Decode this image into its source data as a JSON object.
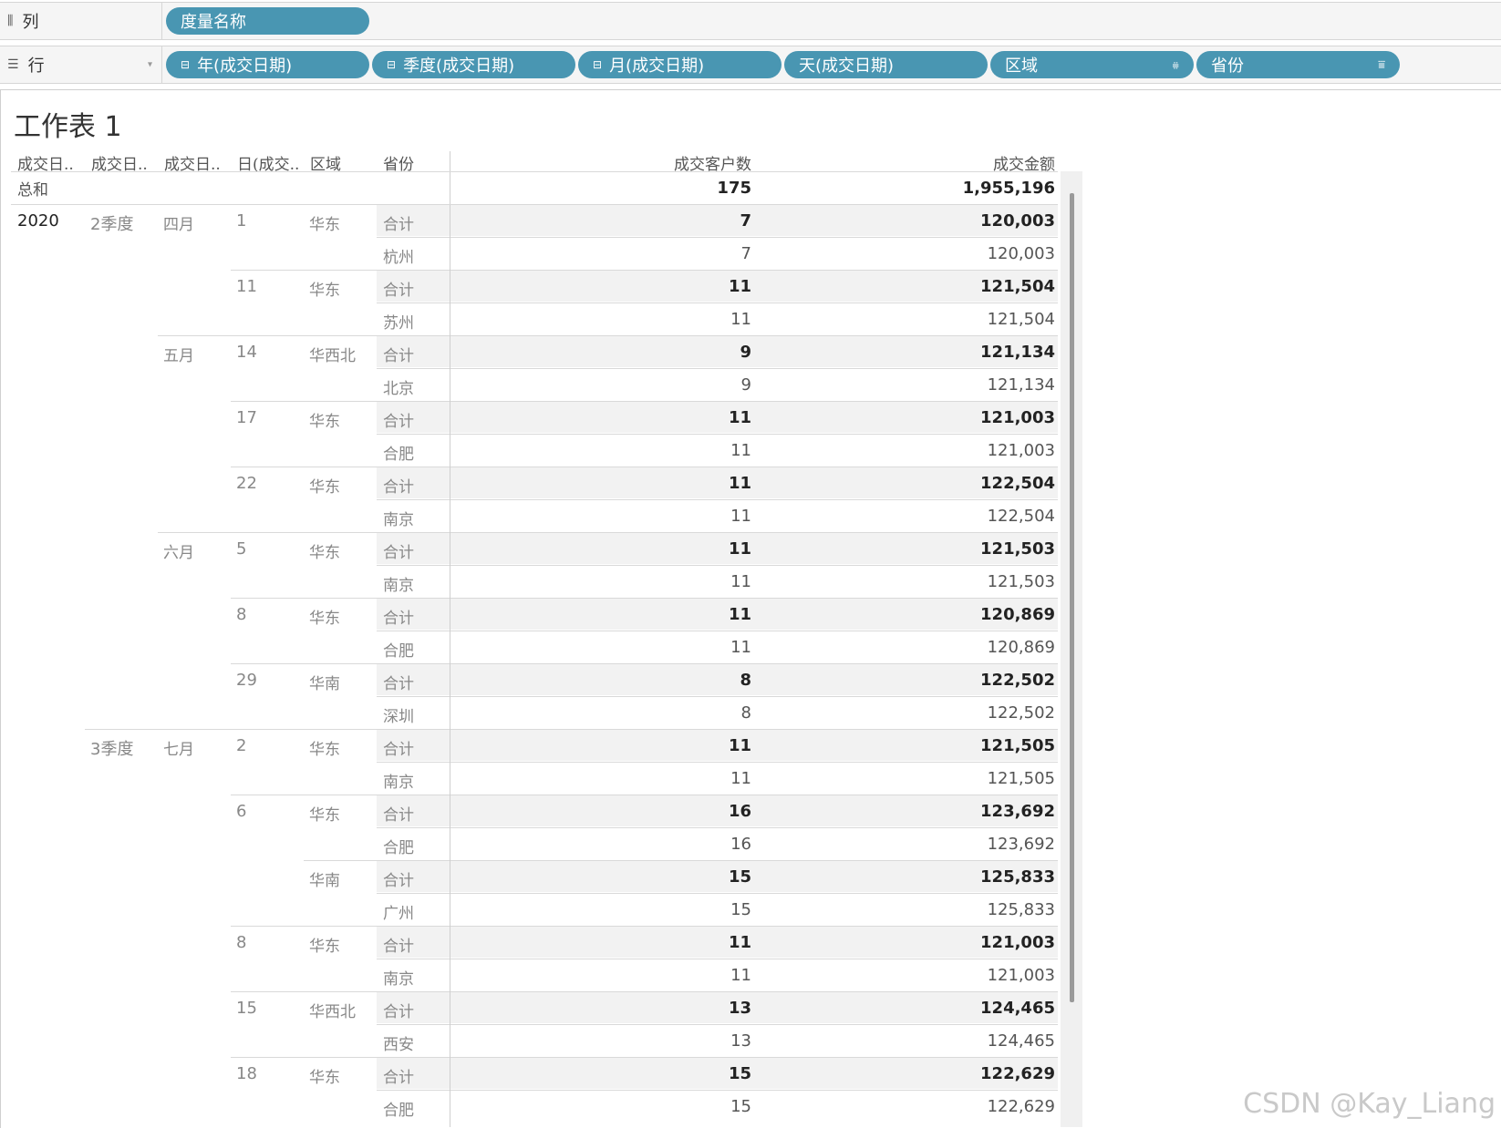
{
  "columns_shelf": {
    "label": "列",
    "icon": "columns-icon",
    "pills": [
      {
        "label": "度量名称"
      }
    ]
  },
  "rows_shelf": {
    "label": "行",
    "icon": "rows-icon",
    "pills": [
      {
        "label": "年(成交日期)",
        "expand": "⊟"
      },
      {
        "label": "季度(成交日期)",
        "expand": "⊟"
      },
      {
        "label": "月(成交日期)",
        "expand": "⊟"
      },
      {
        "label": "天(成交日期)"
      },
      {
        "label": "区域",
        "sort": "sort-desc-icon"
      },
      {
        "label": "省份",
        "sort": "sort-asc-icon"
      }
    ]
  },
  "sheet": {
    "title": "工作表 1",
    "headers": {
      "year": "成交日..",
      "quarter": "成交日..",
      "month": "成交日..",
      "day": "日(成交..",
      "region": "区域",
      "province": "省份",
      "customers": "成交客户数",
      "amount": "成交金额"
    },
    "total": {
      "label": "总和",
      "customers": "175",
      "amount": "1,955,196"
    },
    "rows": [
      {
        "year": "2020",
        "quarter": "2季度",
        "month": "四月",
        "day": "1",
        "region": "华东",
        "province": "合计",
        "customers": "7",
        "amount": "120,003",
        "subtotal": true
      },
      {
        "province": "杭州",
        "customers": "7",
        "amount": "120,003"
      },
      {
        "day": "11",
        "region": "华东",
        "province": "合计",
        "customers": "11",
        "amount": "121,504",
        "subtotal": true
      },
      {
        "province": "苏州",
        "customers": "11",
        "amount": "121,504"
      },
      {
        "month": "五月",
        "day": "14",
        "region": "华西北",
        "province": "合计",
        "customers": "9",
        "amount": "121,134",
        "subtotal": true
      },
      {
        "province": "北京",
        "customers": "9",
        "amount": "121,134"
      },
      {
        "day": "17",
        "region": "华东",
        "province": "合计",
        "customers": "11",
        "amount": "121,003",
        "subtotal": true
      },
      {
        "province": "合肥",
        "customers": "11",
        "amount": "121,003"
      },
      {
        "day": "22",
        "region": "华东",
        "province": "合计",
        "customers": "11",
        "amount": "122,504",
        "subtotal": true
      },
      {
        "province": "南京",
        "customers": "11",
        "amount": "122,504"
      },
      {
        "month": "六月",
        "day": "5",
        "region": "华东",
        "province": "合计",
        "customers": "11",
        "amount": "121,503",
        "subtotal": true
      },
      {
        "province": "南京",
        "customers": "11",
        "amount": "121,503"
      },
      {
        "day": "8",
        "region": "华东",
        "province": "合计",
        "customers": "11",
        "amount": "120,869",
        "subtotal": true
      },
      {
        "province": "合肥",
        "customers": "11",
        "amount": "120,869"
      },
      {
        "day": "29",
        "region": "华南",
        "province": "合计",
        "customers": "8",
        "amount": "122,502",
        "subtotal": true
      },
      {
        "province": "深圳",
        "customers": "8",
        "amount": "122,502"
      },
      {
        "quarter": "3季度",
        "month": "七月",
        "day": "2",
        "region": "华东",
        "province": "合计",
        "customers": "11",
        "amount": "121,505",
        "subtotal": true
      },
      {
        "province": "南京",
        "customers": "11",
        "amount": "121,505"
      },
      {
        "day": "6",
        "region": "华东",
        "province": "合计",
        "customers": "16",
        "amount": "123,692",
        "subtotal": true
      },
      {
        "province": "合肥",
        "customers": "16",
        "amount": "123,692"
      },
      {
        "region": "华南",
        "province": "合计",
        "customers": "15",
        "amount": "125,833",
        "subtotal": true
      },
      {
        "province": "广州",
        "customers": "15",
        "amount": "125,833"
      },
      {
        "day": "8",
        "region": "华东",
        "province": "合计",
        "customers": "11",
        "amount": "121,003",
        "subtotal": true
      },
      {
        "province": "南京",
        "customers": "11",
        "amount": "121,003"
      },
      {
        "day": "15",
        "region": "华西北",
        "province": "合计",
        "customers": "13",
        "amount": "124,465",
        "subtotal": true
      },
      {
        "province": "西安",
        "customers": "13",
        "amount": "124,465"
      },
      {
        "day": "18",
        "region": "华东",
        "province": "合计",
        "customers": "15",
        "amount": "122,629",
        "subtotal": true
      },
      {
        "province": "合肥",
        "customers": "15",
        "amount": "122,629"
      }
    ]
  },
  "watermark": "CSDN @Kay_Liang",
  "colors": {
    "pill": "#4996b2",
    "band": "#f2f2f2"
  }
}
